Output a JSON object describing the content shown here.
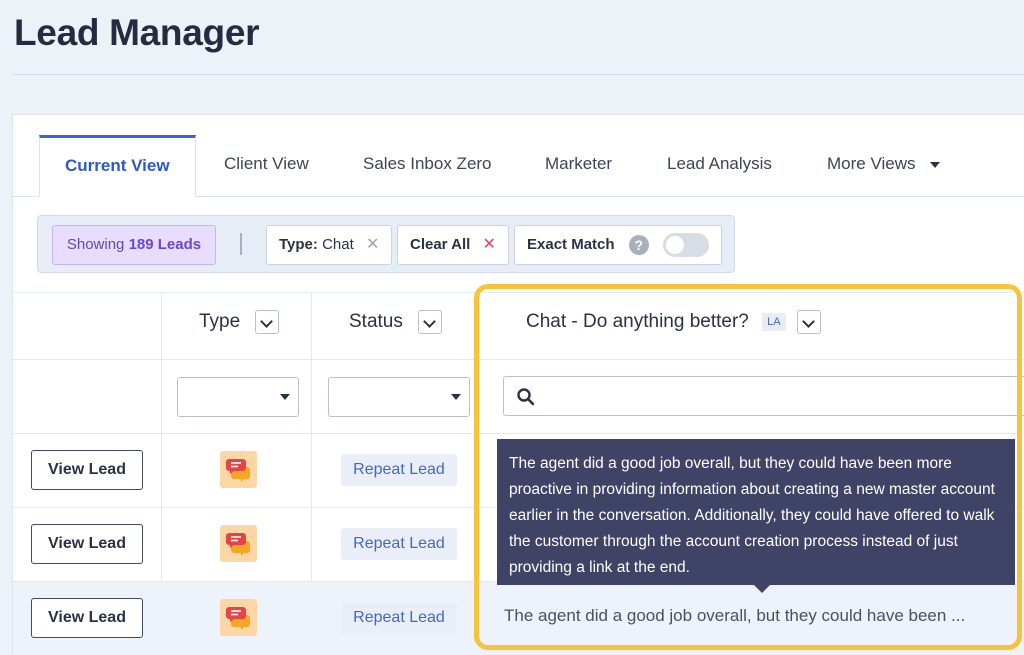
{
  "page": {
    "title": "Lead Manager"
  },
  "tabs": [
    {
      "label": "Current View",
      "active": true
    },
    {
      "label": "Client View",
      "active": false
    },
    {
      "label": "Sales Inbox Zero",
      "active": false
    },
    {
      "label": "Marketer",
      "active": false
    },
    {
      "label": "Lead Analysis",
      "active": false
    },
    {
      "label": "More Views",
      "active": false
    }
  ],
  "filters": {
    "showing_prefix": "Showing",
    "showing_count": "189 Leads",
    "type_label": "Type:",
    "type_value": "Chat",
    "type_remove": "✕",
    "clear_all": "Clear All",
    "clear_all_remove": "✕",
    "exact_match": "Exact Match",
    "exact_match_help": "?",
    "exact_match_enabled": false
  },
  "table": {
    "headers": {
      "type": "Type",
      "status": "Status",
      "chat": "Chat - Do anything better?",
      "chat_badge": "LA"
    },
    "rows": [
      {
        "action": "View Lead",
        "type_icon": "chat-icon",
        "status": "Repeat Lead",
        "chat": ""
      },
      {
        "action": "View Lead",
        "type_icon": "chat-icon",
        "status": "Repeat Lead",
        "chat": ""
      },
      {
        "action": "View Lead",
        "type_icon": "chat-icon",
        "status": "Repeat Lead",
        "chat": "The agent did a good job overall, but they could have been ..."
      }
    ]
  },
  "tooltip": {
    "text": "The agent did a good job overall, but they could have been more proactive in providing information about creating a new master account earlier in the conversation. Additionally, they could have offered to walk the customer through the account creation process instead of just providing a link at the end."
  },
  "colors": {
    "accent": "#3d64d6",
    "highlight": "#f7c23c",
    "tooltip_bg": "#3f4466",
    "badge_purple": "#6a46d6",
    "chat_icon_red": "#e64545",
    "chat_icon_orange": "#f5a623"
  }
}
